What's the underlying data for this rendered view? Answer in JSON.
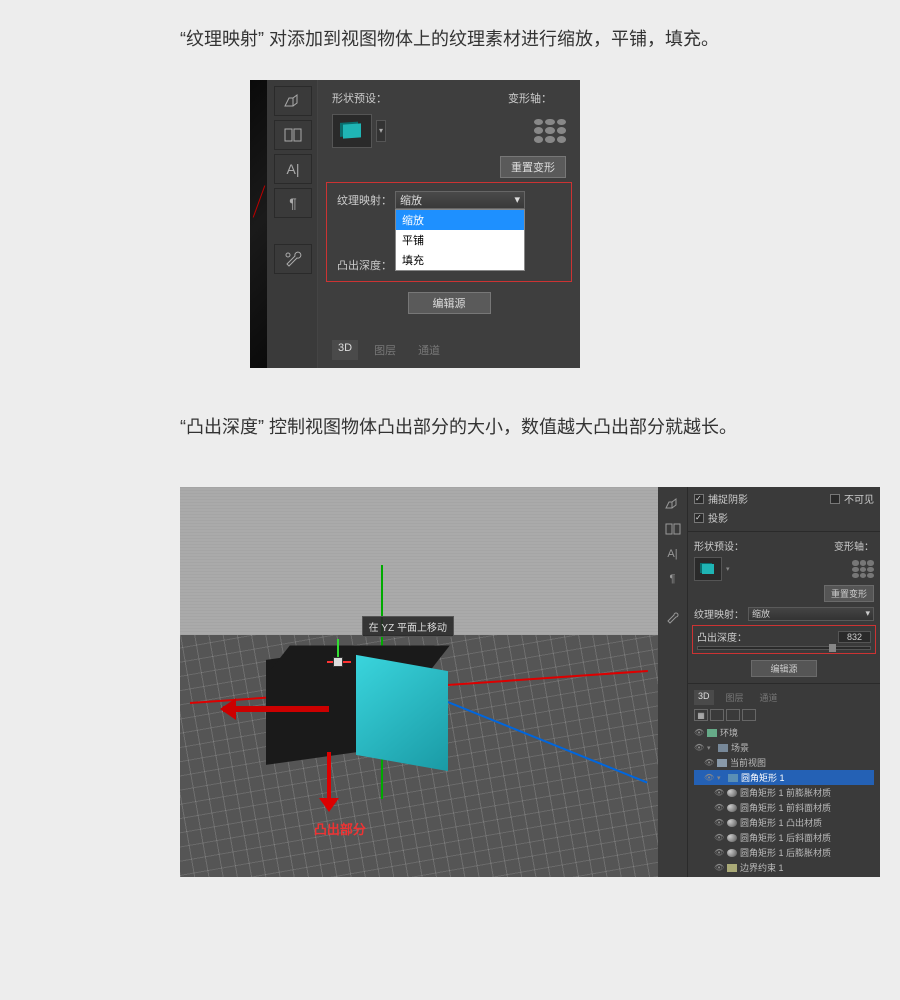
{
  "para1": "“纹理映射” 对添加到视图物体上的纹理素材进行缩放，平铺，填充。",
  "para2": "“凸出深度” 控制视图物体凸出部分的大小，数值越大凸出部分就越长。",
  "panel1": {
    "shape_preset_label": "形状预设：",
    "deform_axis_label": "变形轴：",
    "reset_deform": "重置变形",
    "texture_map_label": "纹理映射：",
    "extrude_depth_label": "凸出深度：",
    "dropdown_value": "缩放",
    "options": {
      "o1": "缩放",
      "o2": "平铺",
      "o3": "填充"
    },
    "edit_source": "编辑源",
    "tabs": {
      "t1": "3D",
      "t2": "图层",
      "t3": "通道"
    }
  },
  "view2": {
    "tooltip": "在 YZ 平面上移动",
    "annotation": "凸出部分"
  },
  "panel2": {
    "catch_shadow": "捕捉阴影",
    "invisible": "不可见",
    "projection": "投影",
    "shape_preset_label": "形状预设：",
    "deform_axis_label": "变形轴：",
    "reset_deform": "重置变形",
    "texture_map_label": "纹理映射：",
    "texture_map_value": "缩放",
    "extrude_depth_label": "凸出深度：",
    "extrude_depth_value": "832",
    "edit_source": "编辑源",
    "tabs": {
      "t1": "3D",
      "t2": "图层",
      "t3": "通道"
    },
    "tree": {
      "env": "环境",
      "scene": "场景",
      "current_view": "当前视图",
      "shape": "圆角矩形 1",
      "mat1": "圆角矩形 1 前膨胀材质",
      "mat2": "圆角矩形 1 前斜面材质",
      "mat3": "圆角矩形 1 凸出材质",
      "mat4": "圆角矩形 1 后斜面材质",
      "mat5": "圆角矩形 1 后膨胀材质",
      "constraint": "边界约束 1"
    }
  }
}
